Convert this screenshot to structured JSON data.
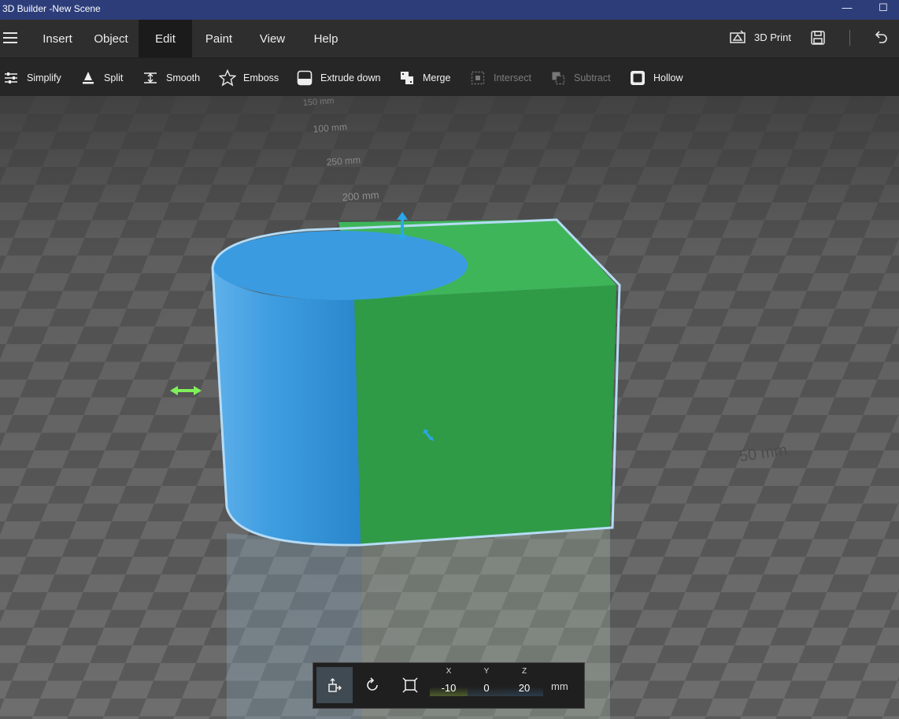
{
  "window": {
    "title": "3D Builder -New Scene",
    "minimize": "—",
    "maximize": "☐"
  },
  "menu": {
    "tabs": [
      {
        "label": "Insert"
      },
      {
        "label": "Object"
      },
      {
        "label": "Edit",
        "active": true
      },
      {
        "label": "Paint"
      },
      {
        "label": "View"
      },
      {
        "label": "Help"
      }
    ],
    "print_label": "3D Print"
  },
  "toolbar": {
    "items": [
      {
        "label": "Simplify",
        "icon": "simplify-icon",
        "enabled": true
      },
      {
        "label": "Split",
        "icon": "split-icon",
        "enabled": true
      },
      {
        "label": "Smooth",
        "icon": "smooth-icon",
        "enabled": true
      },
      {
        "label": "Emboss",
        "icon": "star-icon",
        "enabled": true
      },
      {
        "label": "Extrude down",
        "icon": "extrude-down-icon",
        "enabled": true
      },
      {
        "label": "Merge",
        "icon": "merge-icon",
        "enabled": true
      },
      {
        "label": "Intersect",
        "icon": "intersect-icon",
        "enabled": false
      },
      {
        "label": "Subtract",
        "icon": "subtract-icon",
        "enabled": false
      },
      {
        "label": "Hollow",
        "icon": "hollow-icon",
        "enabled": true
      }
    ]
  },
  "viewport": {
    "grid_labels": [
      "150 mm",
      "100 mm",
      "250 mm",
      "200 mm",
      "50 mm"
    ],
    "colors": {
      "cylinder": "#3a9be0",
      "box": "#2e9e45",
      "outline": "#a8d4f2",
      "gizmo_green": "#7ef05a",
      "gizmo_blue": "#2aa7e8"
    }
  },
  "transform": {
    "x_label": "X",
    "y_label": "Y",
    "z_label": "Z",
    "x": "-10",
    "y": "0",
    "z": "20",
    "unit": "mm"
  }
}
